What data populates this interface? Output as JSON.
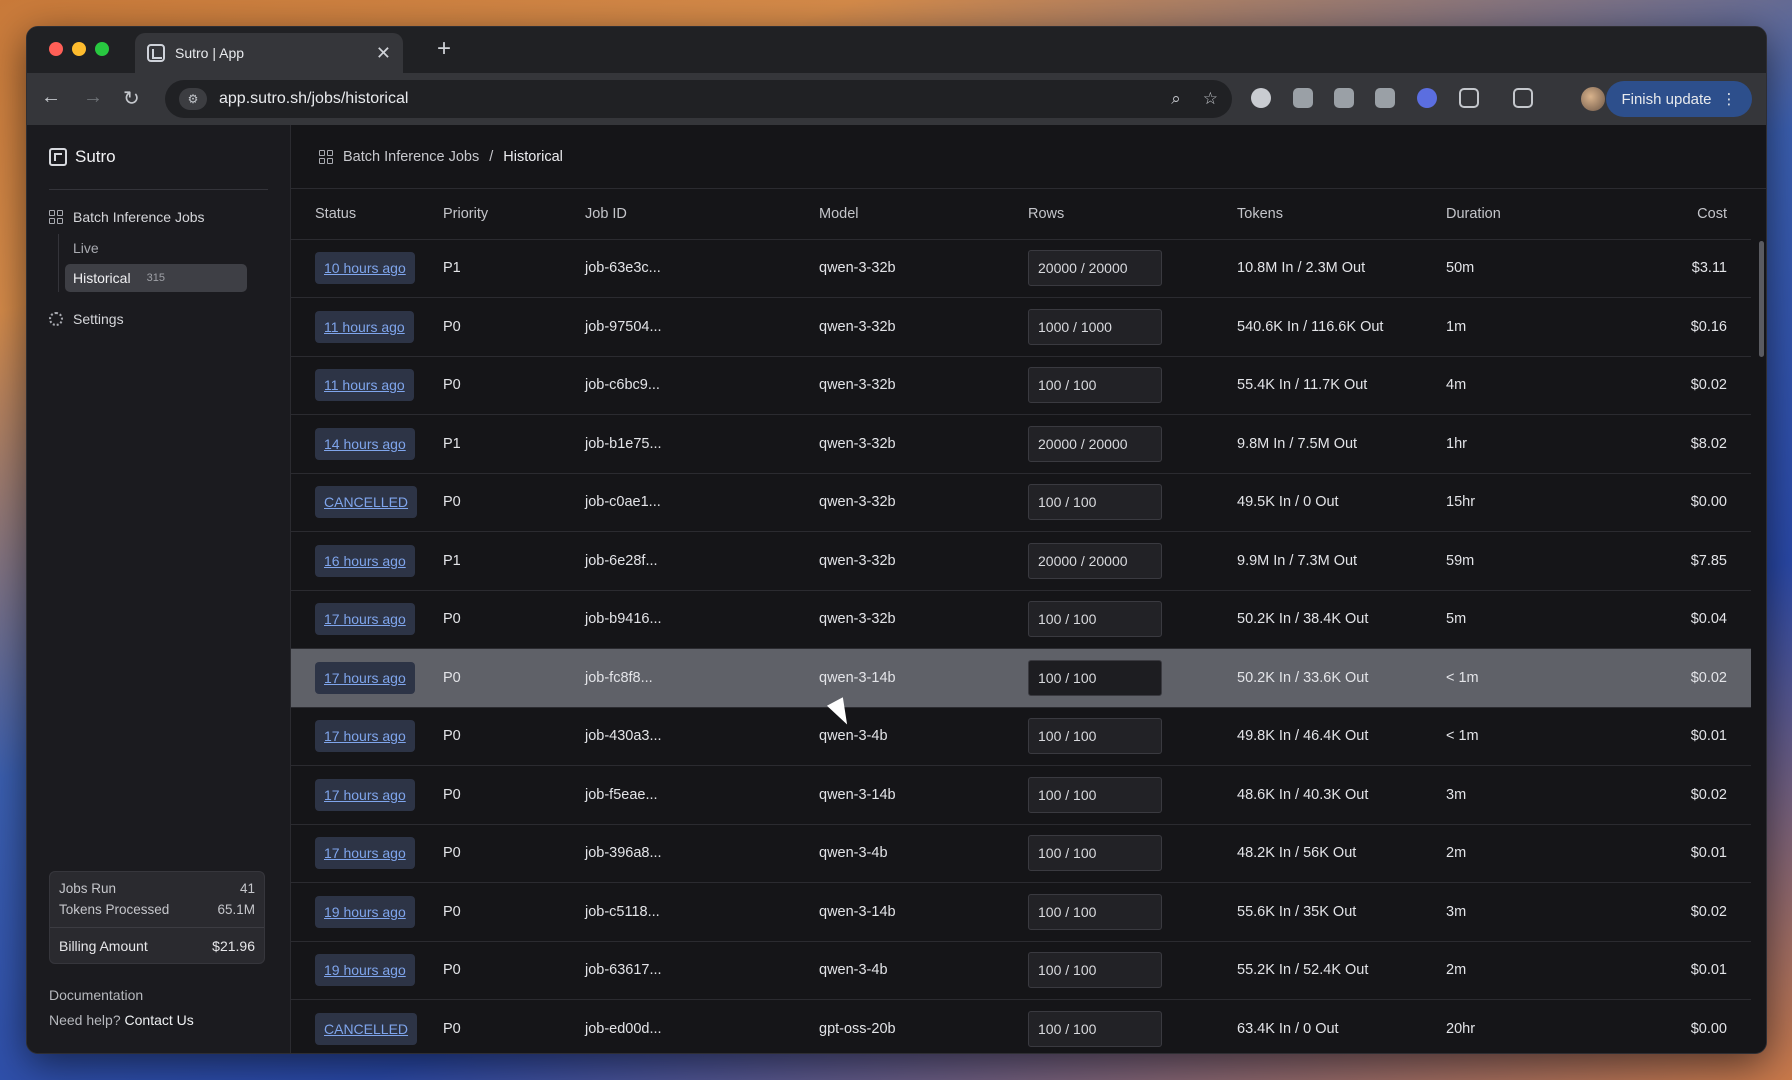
{
  "browser": {
    "tab_title": "Sutro | App",
    "url": "app.sutro.sh/jobs/historical",
    "finish_update": "Finish update"
  },
  "sidebar": {
    "brand": "Sutro",
    "nav": {
      "batch_jobs": "Batch Inference Jobs",
      "live": "Live",
      "historical": "Historical",
      "historical_count": "315",
      "settings": "Settings"
    },
    "stats": {
      "jobs_run_label": "Jobs Run",
      "jobs_run_value": "41",
      "tokens_label": "Tokens Processed",
      "tokens_value": "65.1M",
      "billing_label": "Billing Amount",
      "billing_value": "$21.96"
    },
    "footer": {
      "documentation": "Documentation",
      "need_help": "Need help?",
      "contact": "Contact Us"
    }
  },
  "breadcrumb": {
    "parent": "Batch Inference Jobs",
    "separator": "/",
    "current": "Historical"
  },
  "table": {
    "headers": [
      "Status",
      "Priority",
      "Job ID",
      "Model",
      "Rows",
      "Tokens",
      "Duration",
      "Cost"
    ],
    "rows": [
      {
        "status": "10 hours ago",
        "priority": "P1",
        "job_id": "job-63e3c...",
        "model": "qwen-3-32b",
        "rows": "20000 / 20000",
        "tokens": "10.8M In / 2.3M Out",
        "duration": "50m",
        "cost": "$3.11"
      },
      {
        "status": "11 hours ago",
        "priority": "P0",
        "job_id": "job-97504...",
        "model": "qwen-3-32b",
        "rows": "1000 / 1000",
        "tokens": "540.6K In / 116.6K Out",
        "duration": "1m",
        "cost": "$0.16"
      },
      {
        "status": "11 hours ago",
        "priority": "P0",
        "job_id": "job-c6bc9...",
        "model": "qwen-3-32b",
        "rows": "100 / 100",
        "tokens": "55.4K In / 11.7K Out",
        "duration": "4m",
        "cost": "$0.02"
      },
      {
        "status": "14 hours ago",
        "priority": "P1",
        "job_id": "job-b1e75...",
        "model": "qwen-3-32b",
        "rows": "20000 / 20000",
        "tokens": "9.8M In / 7.5M Out",
        "duration": "1hr",
        "cost": "$8.02"
      },
      {
        "status": "CANCELLED",
        "priority": "P0",
        "job_id": "job-c0ae1...",
        "model": "qwen-3-32b",
        "rows": "100 / 100",
        "tokens": "49.5K In / 0 Out",
        "duration": "15hr",
        "cost": "$0.00"
      },
      {
        "status": "16 hours ago",
        "priority": "P1",
        "job_id": "job-6e28f...",
        "model": "qwen-3-32b",
        "rows": "20000 / 20000",
        "tokens": "9.9M In / 7.3M Out",
        "duration": "59m",
        "cost": "$7.85"
      },
      {
        "status": "17 hours ago",
        "priority": "P0",
        "job_id": "job-b9416...",
        "model": "qwen-3-32b",
        "rows": "100 / 100",
        "tokens": "50.2K In / 38.4K Out",
        "duration": "5m",
        "cost": "$0.04"
      },
      {
        "status": "17 hours ago",
        "priority": "P0",
        "job_id": "job-fc8f8...",
        "model": "qwen-3-14b",
        "rows": "100 / 100",
        "tokens": "50.2K In / 33.6K Out",
        "duration": "< 1m",
        "cost": "$0.02"
      },
      {
        "status": "17 hours ago",
        "priority": "P0",
        "job_id": "job-430a3...",
        "model": "qwen-3-4b",
        "rows": "100 / 100",
        "tokens": "49.8K In / 46.4K Out",
        "duration": "< 1m",
        "cost": "$0.01"
      },
      {
        "status": "17 hours ago",
        "priority": "P0",
        "job_id": "job-f5eae...",
        "model": "qwen-3-14b",
        "rows": "100 / 100",
        "tokens": "48.6K In / 40.3K Out",
        "duration": "3m",
        "cost": "$0.02"
      },
      {
        "status": "17 hours ago",
        "priority": "P0",
        "job_id": "job-396a8...",
        "model": "qwen-3-4b",
        "rows": "100 / 100",
        "tokens": "48.2K In / 56K Out",
        "duration": "2m",
        "cost": "$0.01"
      },
      {
        "status": "19 hours ago",
        "priority": "P0",
        "job_id": "job-c5118...",
        "model": "qwen-3-14b",
        "rows": "100 / 100",
        "tokens": "55.6K In / 35K Out",
        "duration": "3m",
        "cost": "$0.02"
      },
      {
        "status": "19 hours ago",
        "priority": "P0",
        "job_id": "job-63617...",
        "model": "qwen-3-4b",
        "rows": "100 / 100",
        "tokens": "55.2K In / 52.4K Out",
        "duration": "2m",
        "cost": "$0.01"
      },
      {
        "status": "CANCELLED",
        "priority": "P0",
        "job_id": "job-ed00d...",
        "model": "gpt-oss-20b",
        "rows": "100 / 100",
        "tokens": "63.4K In / 0 Out",
        "duration": "20hr",
        "cost": "$0.00"
      }
    ]
  },
  "highlighted_row_index": 7,
  "colors": {
    "accent_link": "#7fa5ec",
    "status_pill_bg": "#2d3446",
    "row_highlight": "#5f6168",
    "finish_update_bg": "#2d4f8c"
  }
}
